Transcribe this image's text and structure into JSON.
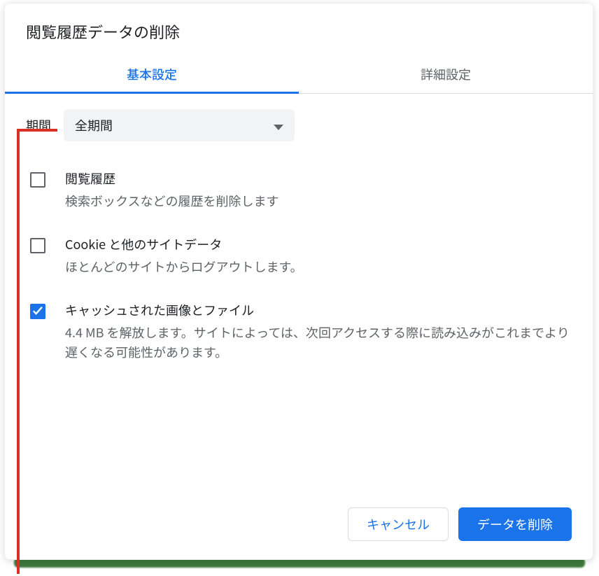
{
  "dialog": {
    "title": "閲覧履歴データの削除",
    "tabs": {
      "basic": "基本設定",
      "advanced": "詳細設定"
    },
    "time_range": {
      "label": "期間",
      "selected": "全期間"
    },
    "options": [
      {
        "title": "閲覧履歴",
        "desc": "検索ボックスなどの履歴を削除します",
        "checked": false
      },
      {
        "title": "Cookie と他のサイトデータ",
        "desc": "ほとんどのサイトからログアウトします。",
        "checked": false
      },
      {
        "title": "キャッシュされた画像とファイル",
        "desc": "4.4 MB を解放します。サイトによっては、次回アクセスする際に読み込みがこれまでより遅くなる可能性があります。",
        "checked": true
      }
    ],
    "actions": {
      "cancel": "キャンセル",
      "confirm": "データを削除"
    }
  }
}
